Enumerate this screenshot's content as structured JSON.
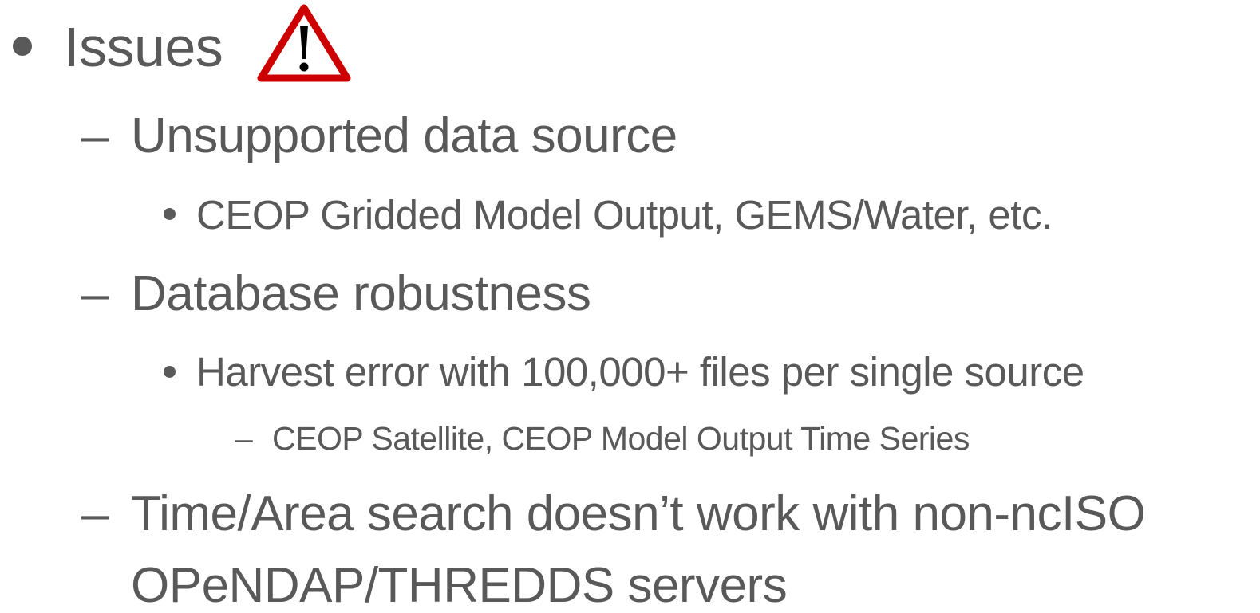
{
  "slide": {
    "level1": {
      "text": "Issues",
      "icon": "warning-triangle-icon"
    },
    "item_unsupported": {
      "text": "Unsupported data source",
      "sub": "CEOP Gridded Model Output, GEMS/Water, etc."
    },
    "item_database": {
      "text": "Database robustness",
      "sub": "Harvest error with 100,000+ files per single source",
      "subsub": "CEOP Satellite, CEOP Model Output Time Series"
    },
    "item_timearea": {
      "line1": "Time/Area search doesn’t work with non-ncISO",
      "line2": "OPeNDAP/THREDDS servers"
    },
    "dash": "–",
    "colors": {
      "text": "#595959",
      "warning_red": "#cc0000",
      "warning_fill": "#ffffff"
    }
  }
}
